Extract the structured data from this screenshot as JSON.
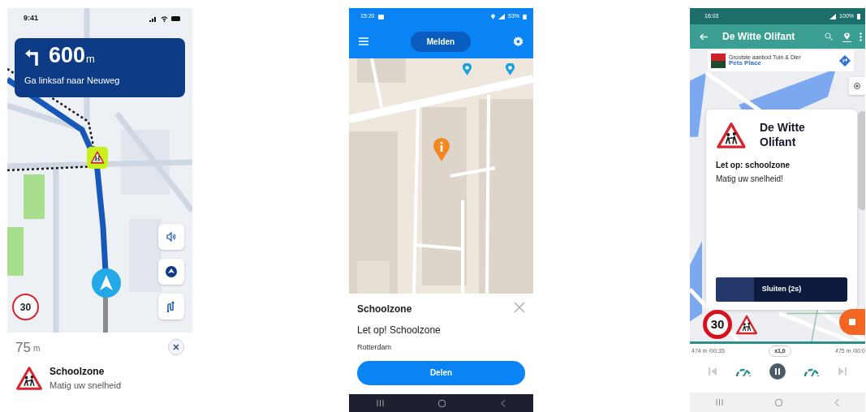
{
  "navigation_app": {
    "status_bar": {
      "time": "9:41"
    },
    "instruction": {
      "distance": "600",
      "unit": "m",
      "text": "Ga linksaf naar Neuweg"
    },
    "speed_limit": "30",
    "alert": {
      "distance": "75",
      "unit": "m",
      "title": "Schoolzone",
      "subtitle": "Matig uw snelheid"
    }
  },
  "report_app": {
    "status_bar": {
      "time": "15:20",
      "battery": "53%"
    },
    "app_bar": {
      "button": "Melden"
    },
    "sheet": {
      "title": "Schoolzone",
      "message": "Let op! Schoolzone",
      "place": "Rotterdam",
      "button": "Delen"
    }
  },
  "route_app": {
    "status_bar": {
      "time": "16:03",
      "battery": "100%"
    },
    "app_bar": {
      "title": "De Witte Olifant"
    },
    "ad": {
      "headline": "Grootste aanbod Tuin & Dier",
      "advertiser": "Pets Place"
    },
    "dialog": {
      "title": "De Witte Olifant",
      "message": "Let op: schoolzone",
      "subtitle": "Matig uw snelheid!",
      "button": "Sluiten (2s)",
      "level": 0.29
    },
    "speed_limit": "30",
    "playback": {
      "left": "474 m /00:35",
      "speed": "x1,0",
      "right": "475 m /00:0"
    }
  }
}
